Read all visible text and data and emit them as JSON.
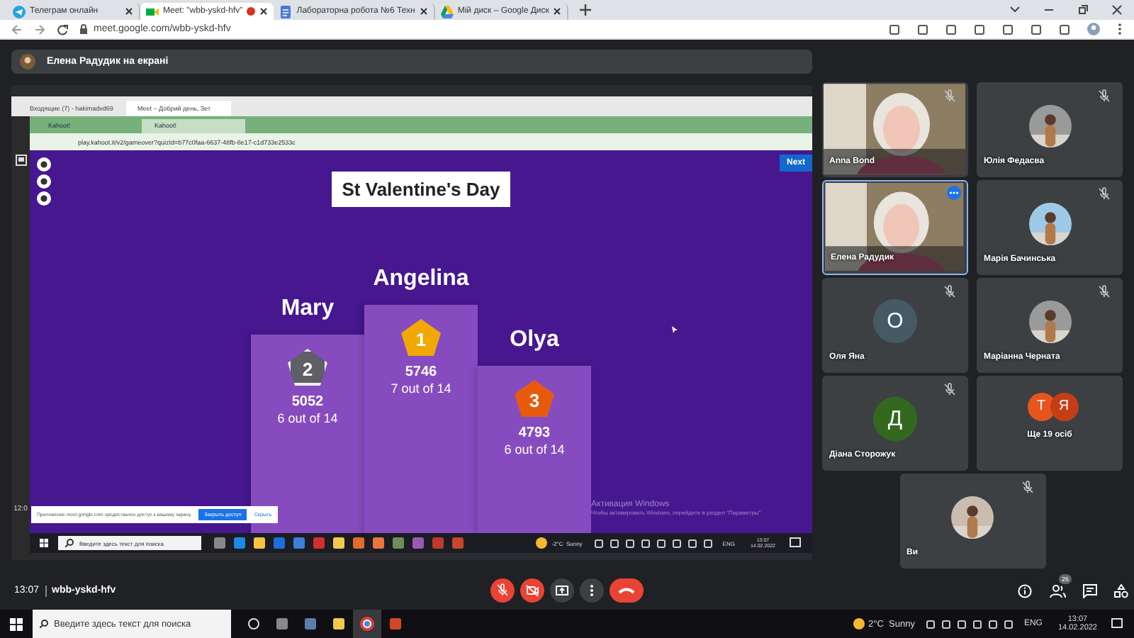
{
  "browser": {
    "tabs": [
      {
        "title": "Телеграм онлайн",
        "selected": false,
        "recording": false
      },
      {
        "title": "Meet: \"wbb-yskd-hfv\"",
        "selected": true,
        "recording": true
      },
      {
        "title": "Лабораторна робота №6 Техн",
        "selected": false,
        "recording": false
      },
      {
        "title": "Мій диск – Google Диск",
        "selected": false,
        "recording": false
      }
    ],
    "url": "meet.google.com/wbb-yskd-hfv"
  },
  "presenter_banner": "Елена Радудик на екрані",
  "shared_screen": {
    "outer_tabs": [
      {
        "title": "Входящие (7) - hakimadvd69",
        "selected": false
      },
      {
        "title": "Meet – Добрий день, Зет",
        "selected": true
      }
    ],
    "inner_tabs": [
      {
        "title": "Kahoot!",
        "selected": false
      },
      {
        "title": "Kahoot!",
        "selected": true
      }
    ],
    "inner_url": "play.kahoot.it/v2/gameover?quizId=b77c0faa-6637-48fb-8e17-c1d733e2533c",
    "game": {
      "title": "St Valentine's Day",
      "next_button": "Next",
      "podium": [
        {
          "name": "Mary",
          "rank": "2",
          "score": "5052",
          "correct": "6 out of 14",
          "kind": "silver"
        },
        {
          "name": "Angelina",
          "rank": "1",
          "score": "5746",
          "correct": "7 out of 14",
          "kind": "gold"
        },
        {
          "name": "Olya",
          "rank": "3",
          "score": "4793",
          "correct": "6 out of 14",
          "kind": "bronze"
        }
      ]
    },
    "clock_fragment": "12:0",
    "share_notice": {
      "text": "Приложение meet.google.com предоставлен доступ к вашему экрану.",
      "stop_button": "Закрыть доступ",
      "hide_link": "Скрыть"
    },
    "activation": {
      "title": "Активация Windows",
      "text": "Чтобы активировать Windows, перейдите в раздел \"Параметры\"."
    },
    "taskbar": {
      "search_placeholder": "Введите здесь текст для поиска",
      "weather": "-2°C  Sunny",
      "lang": "ENG",
      "time": "13:07",
      "date": "14.02.2022"
    }
  },
  "participants": [
    {
      "name": "Anna Bond",
      "kind": "video",
      "muted": true,
      "speaking": false
    },
    {
      "name": "Юлія Федасва",
      "muted": true,
      "speaking": false
    },
    {
      "name": "Елена Радудик",
      "kind": "video",
      "muted": false,
      "speaking": true
    },
    {
      "name": "Марія Бачинська",
      "muted": true,
      "speaking": false
    },
    {
      "name": "Оля Яна",
      "kind": "letter",
      "letter": "О",
      "color": "#455a64",
      "muted": true,
      "speaking": false
    },
    {
      "name": "Маріанна Черната",
      "muted": true,
      "speaking": false
    },
    {
      "name": "Діана Сторожук",
      "kind": "letter",
      "letter": "Д",
      "color": "#33691e",
      "muted": true,
      "speaking": false
    },
    {
      "name": "Ще 19 осіб",
      "kind": "more",
      "avatars": [
        {
          "letter": "Т",
          "color": "#e8541e"
        },
        {
          "letter": "Я",
          "color": "#c53d17"
        }
      ]
    },
    {
      "name": "Ви",
      "muted": true,
      "speaking": false
    }
  ],
  "call_bar": {
    "time": "13:07",
    "meeting_code": "wbb-yskd-hfv",
    "people_count": "26"
  },
  "taskbar": {
    "search_placeholder": "Введите здесь текст для поиска",
    "weather": "2°C  Sunny",
    "lang": "ENG",
    "time": "13:07",
    "date": "14.02.2022"
  }
}
